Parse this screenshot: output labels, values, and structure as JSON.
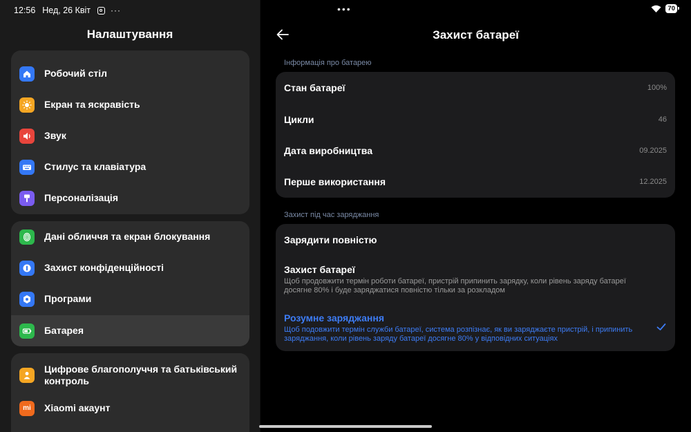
{
  "status": {
    "time": "12:56",
    "date": "Нед, 26 Квіт",
    "battery": "70",
    "more": "···",
    "center_dots": "•••"
  },
  "left": {
    "title": "Налаштування",
    "items": [
      {
        "label": "Робочий стіл",
        "icon": "home-icon",
        "color": "#3478f6"
      },
      {
        "label": "Екран та яскравість",
        "icon": "sun-icon",
        "color": "#f5a623"
      },
      {
        "label": "Звук",
        "icon": "speaker-icon",
        "color": "#e8453c"
      },
      {
        "label": "Стилус та клавіатура",
        "icon": "keyboard-icon",
        "color": "#3478f6"
      },
      {
        "label": "Персоналізація",
        "icon": "brush-icon",
        "color": "#7a5cf0"
      },
      {
        "label": "Дані обличчя та екран блокування",
        "icon": "fingerprint-icon",
        "color": "#2db84c"
      },
      {
        "label": "Захист конфіденційності",
        "icon": "shield-icon",
        "color": "#3478f6"
      },
      {
        "label": "Програми",
        "icon": "gear-icon",
        "color": "#3478f6"
      },
      {
        "label": "Батарея",
        "icon": "battery-icon",
        "color": "#2db84c"
      },
      {
        "label": "Цифрове благополуччя та батьківський контроль",
        "icon": "person-icon",
        "color": "#f5a623"
      },
      {
        "label": "Xiaomi акаунт",
        "icon": "mi-icon",
        "color": "#f06a1d"
      }
    ]
  },
  "right": {
    "title": "Захист батареї",
    "info_header": "Інформація про батарею",
    "info_rows": [
      {
        "label": "Стан батареї",
        "value": "100%"
      },
      {
        "label": "Цикли",
        "value": "46"
      },
      {
        "label": "Дата виробництва",
        "value": "09.2025"
      },
      {
        "label": "Перше використання",
        "value": "12.2025"
      }
    ],
    "charge_header": "Захист під час заряджання",
    "options": [
      {
        "title": "Зарядити повністю",
        "desc": ""
      },
      {
        "title": "Захист батареї",
        "desc": "Щоб продовжити термін роботи батареї, пристрій припинить зарядку, коли рівень заряду батареї досягне 80% і буде заряджатися повністю тільки за розкладом"
      },
      {
        "title": "Розумне заряджання",
        "desc": "Щоб подовжити термін служби батареї, система розпізнає, як ви заряджаєте пристрій, і припинить заряджання, коли рівень заряду батареї досягне 80% у відповідних ситуаціях"
      }
    ],
    "accent": "#3d7cf5"
  }
}
